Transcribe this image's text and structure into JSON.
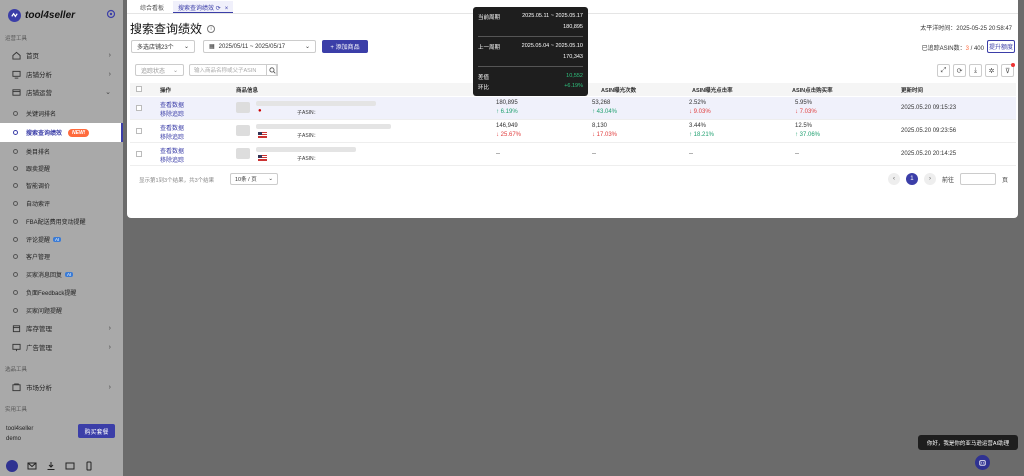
{
  "app": {
    "name": "tool4seller"
  },
  "sidebar": {
    "section_ops": "运营工具",
    "section_select": "选品工具",
    "section_practical": "实用工具",
    "nav": [
      {
        "label": "首页"
      },
      {
        "label": "店铺分析"
      },
      {
        "label": "店铺运营"
      }
    ],
    "sub": [
      {
        "label": "关键词排名"
      },
      {
        "label": "搜索查询绩效",
        "badge": "NEW!"
      },
      {
        "label": "类目排名"
      },
      {
        "label": "跟卖提醒"
      },
      {
        "label": "智能调价"
      },
      {
        "label": "自动索评"
      },
      {
        "label": "FBA配送费用变动提醒"
      },
      {
        "label": "评论提醒",
        "badge": "AI"
      },
      {
        "label": "客户管理"
      },
      {
        "label": "买家消息回复",
        "badge": "AI"
      },
      {
        "label": "负面Feedback提醒"
      },
      {
        "label": "买家问题提醒"
      }
    ],
    "nav2": [
      {
        "label": "库存管理"
      },
      {
        "label": "广告管理"
      }
    ],
    "market": {
      "label": "市场分析"
    },
    "user": {
      "name": "tool4seller",
      "plan": "demo"
    },
    "buy_label": "购买套餐"
  },
  "tabs": [
    {
      "label": "综合看板"
    },
    {
      "label": "搜索查询绩效"
    }
  ],
  "page": {
    "title": "搜索查询绩效",
    "timezone": "太平洋时间：2025-05-25 20:58:47",
    "store_select": "多选店铺23个",
    "date_range": "2025/05/11 ~ 2025/05/17",
    "add_label": "+ 添加商品",
    "tracked_label": "已追踪ASIN数：",
    "tracked_used": "3",
    "tracked_total": "/ 400",
    "upgrade_label": "提升额度",
    "status_select": "追踪状态",
    "search_placeholder": "输入商品名称或父子ASIN"
  },
  "table": {
    "headers": [
      "操作",
      "商品信息",
      "ASIN曝光次数",
      "ASIN曝光点击率",
      "ASIN点击购买率",
      "更新时间"
    ],
    "action_view": "查看数据",
    "action_remove": "移除追踪",
    "child_asin": "子ASIN：",
    "rows": [
      {
        "c1": "180,895",
        "c1d": "↑ 6.19%",
        "c2": "53,268",
        "c2d": "↑ 43.04%",
        "c3": "2.52%",
        "c3d": "↓ 9.03%",
        "c4": "5.95%",
        "c4d": "↓ 7.03%",
        "time": "2025.05.20  09:15:23"
      },
      {
        "c1": "146,949",
        "c1d": "↓ 25.67%",
        "c2": "8,130",
        "c2d": "↓ 17.03%",
        "c3": "3.44%",
        "c3d": "↑ 18.21%",
        "c4": "12.5%",
        "c4d": "↑ 37.06%",
        "time": "2025.05.20  09:23:56"
      },
      {
        "c1": "--",
        "c1d": "",
        "c2": "--",
        "c2d": "",
        "c3": "--",
        "c3d": "",
        "c4": "--",
        "c4d": "",
        "time": "2025.05.20  20:14:25"
      }
    ],
    "footer": "显示第1到3个结果，共3个结果",
    "page_size": "10条 / 页",
    "current_page": "1",
    "goto_label": "前往",
    "page_unit": "页"
  },
  "tooltip": {
    "current_label": "当前周期",
    "current_range": "2025.05.11 ~ 2025.05.17",
    "current_value": "180,895",
    "prev_label": "上一周期",
    "prev_range": "2025.05.04 ~ 2025.05.10",
    "prev_value": "170,343",
    "diff_label": "差值",
    "diff_value": "10,552",
    "ratio_label": "环比",
    "ratio_value": "+6.19%"
  },
  "ai_tip": "你好，我是你的亚马逊运营AI助理",
  "colors": {
    "primary": "#3b3ea8",
    "up": "#20a070",
    "down": "#e03c3c",
    "badge_new": "#ff6b3d"
  }
}
